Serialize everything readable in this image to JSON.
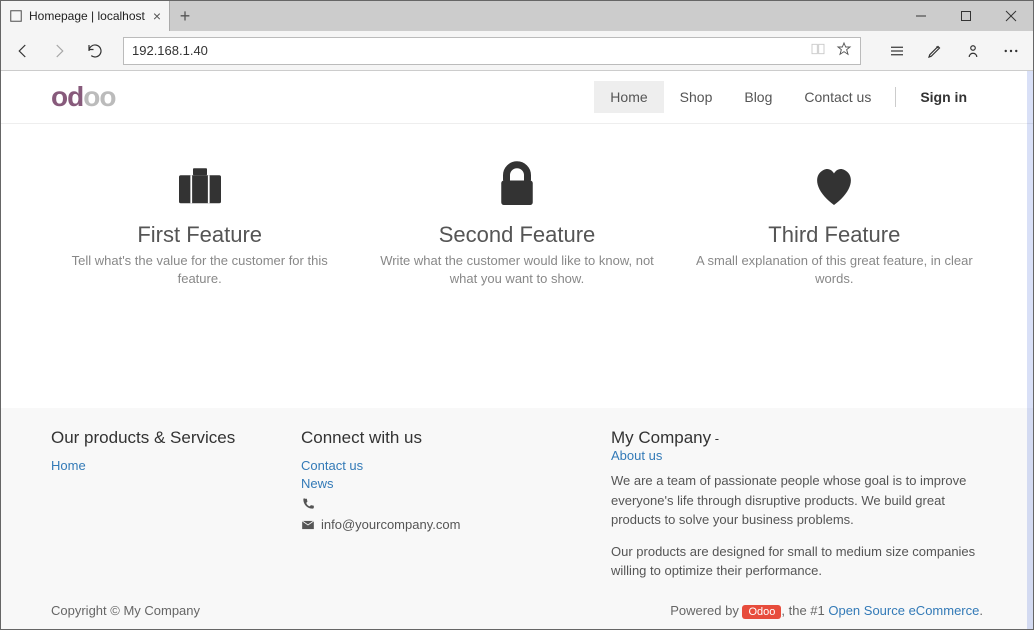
{
  "browser": {
    "tab_title": "Homepage | localhost",
    "address": "192.168.1.40"
  },
  "nav": {
    "items": [
      "Home",
      "Shop",
      "Blog",
      "Contact us"
    ],
    "signin": "Sign in",
    "active_index": 0
  },
  "features": [
    {
      "title": "First Feature",
      "desc": "Tell what's the value for the customer for this feature."
    },
    {
      "title": "Second Feature",
      "desc": "Write what the customer would like to know, not what you want to show."
    },
    {
      "title": "Third Feature",
      "desc": "A small explanation of this great feature, in clear words."
    }
  ],
  "footer": {
    "col1_title": "Our products & Services",
    "col1_links": [
      "Home"
    ],
    "col2_title": "Connect with us",
    "col2_links": [
      "Contact us",
      "News"
    ],
    "email": "info@yourcompany.com",
    "company_title": "My Company",
    "about_sep": " - ",
    "about_label": "About us",
    "company_desc1": "We are a team of passionate people whose goal is to improve everyone's life through disruptive products. We build great products to solve your business problems.",
    "company_desc2": "Our products are designed for small to medium size companies willing to optimize their performance.",
    "copyright": "Copyright © My Company",
    "powered_prefix": "Powered by ",
    "odoo_badge": "Odoo",
    "powered_mid": ", the #1 ",
    "powered_link": "Open Source eCommerce",
    "powered_suffix": "."
  }
}
